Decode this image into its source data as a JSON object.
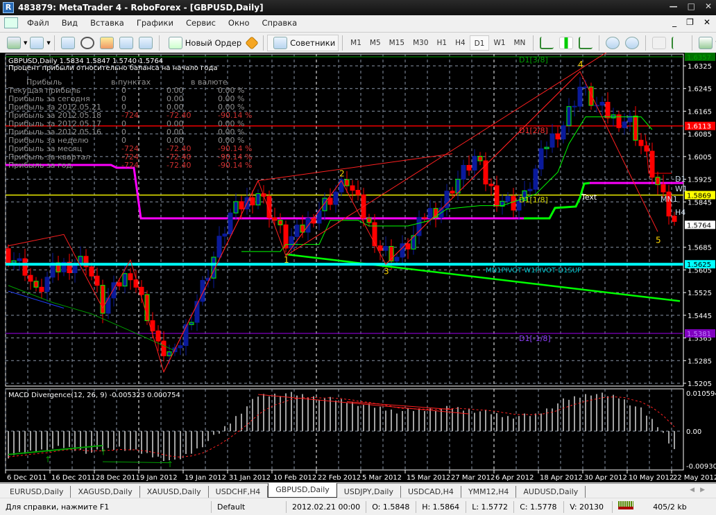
{
  "window": {
    "title": "483879: MetaTrader 4 - RoboForex - [GBPUSD,Daily]",
    "app_icon": "R"
  },
  "menu": [
    "Файл",
    "Вид",
    "Вставка",
    "Графики",
    "Сервис",
    "Окно",
    "Справка"
  ],
  "toolbar": {
    "new_order": "Новый Ордер",
    "experts": "Советники",
    "timeframes": [
      "M1",
      "M5",
      "M15",
      "M30",
      "H1",
      "H4",
      "D1",
      "W1",
      "MN"
    ],
    "active_timeframe": "D1"
  },
  "chart": {
    "symbol_info": "GBPUSD,Daily  1.5834 1.5847 1.5740 1.5764",
    "panel_title": "Процент прибыли относительно баланса на начало года",
    "panel_headers": [
      "Прибыль",
      "в пунктах",
      "в валюте"
    ],
    "panel_rows": [
      {
        "label": "Текущая прибыль",
        "points": "0",
        "money": "0.00",
        "pct": "0.00 %",
        "neg": false
      },
      {
        "label": "Прибыль за сегодня",
        "points": "0",
        "money": "0.00",
        "pct": "0.00 %",
        "neg": false
      },
      {
        "label": "Прибыль за 2012.05.21",
        "points": "0",
        "money": "0.00",
        "pct": "0.00 %",
        "neg": false
      },
      {
        "label": "Прибыль за 2012.05.18",
        "points": "-724",
        "money": "-72.40",
        "pct": "-90.14 %",
        "neg": true
      },
      {
        "label": "Прибыль за 2012.05.17",
        "points": "0",
        "money": "0.00",
        "pct": "0.00 %",
        "neg": false
      },
      {
        "label": "Прибыль за 2012.05.16",
        "points": "0",
        "money": "0.00",
        "pct": "0.00 %",
        "neg": false
      },
      {
        "label": "Прибыль за неделю",
        "points": "0",
        "money": "0.00",
        "pct": "0.00 %",
        "neg": false
      },
      {
        "label": "Прибыль за месяц",
        "points": "-724",
        "money": "-72.40",
        "pct": "-90.14 %",
        "neg": true
      },
      {
        "label": "Прибыль за квартал",
        "points": "-724",
        "money": "-72.40",
        "pct": "-90.14 %",
        "neg": true
      },
      {
        "label": "Прибыль за год",
        "points": "-724",
        "money": "-72.40",
        "pct": "-90.14 %",
        "neg": true
      }
    ],
    "price_range": [
      1.5195,
      1.6375
    ],
    "price_ticks": [
      "1.6325",
      "1.6245",
      "1.6165",
      "1.6085",
      "1.6005",
      "1.5925",
      "1.5845",
      "1.5685",
      "1.5605",
      "1.5525",
      "1.5445",
      "1.5365",
      "1.5285",
      "1.5205"
    ],
    "price_markers": [
      {
        "value": "1.6357",
        "bg": "#007000",
        "fg": "#00a000"
      },
      {
        "value": "1.6113",
        "bg": "#ff0000",
        "fg": "#ffffff"
      },
      {
        "value": "1.5869",
        "bg": "#ffff00",
        "fg": "#000000"
      },
      {
        "value": "1.5764",
        "bg": "#ffffff",
        "fg": "#000000"
      },
      {
        "value": "1.5625",
        "bg": "#00ffff",
        "fg": "#000000"
      },
      {
        "value": "1.5381",
        "bg": "#8000c0",
        "fg": "#c080ff"
      }
    ],
    "time_labels": [
      "6 Dec 2011",
      "16 Dec 2011",
      "28 Dec 2011",
      "9 Jan 2012",
      "19 Jan 2012",
      "31 Jan 2012",
      "10 Feb 2012",
      "22 Feb 2012",
      "5 Mar 2012",
      "15 Mar 2012",
      "27 Mar 2012",
      "6 Apr 2012",
      "18 Apr 2012",
      "30 Apr 2012",
      "10 May 2012",
      "22 May 2012"
    ],
    "close_keypoints": [
      [
        0,
        1.566
      ],
      [
        3,
        1.561
      ],
      [
        5,
        1.552
      ],
      [
        8,
        1.56
      ],
      [
        10,
        1.562
      ],
      [
        14,
        1.564
      ],
      [
        17,
        1.547
      ],
      [
        20,
        1.556
      ],
      [
        22,
        1.56
      ],
      [
        25,
        1.545
      ],
      [
        27,
        1.533
      ],
      [
        30,
        1.53
      ],
      [
        34,
        1.55
      ],
      [
        38,
        1.57
      ],
      [
        40,
        1.58
      ],
      [
        45,
        1.588
      ],
      [
        48,
        1.578
      ],
      [
        50,
        1.57
      ],
      [
        53,
        1.575
      ],
      [
        55,
        1.58
      ],
      [
        58,
        1.586
      ],
      [
        61,
        1.592
      ],
      [
        64,
        1.58
      ],
      [
        67,
        1.568
      ],
      [
        70,
        1.565
      ],
      [
        73,
        1.572
      ],
      [
        75,
        1.58
      ],
      [
        78,
        1.583
      ],
      [
        80,
        1.59
      ],
      [
        84,
        1.6
      ],
      [
        86,
        1.592
      ],
      [
        88,
        1.586
      ],
      [
        91,
        1.584
      ],
      [
        93,
        1.586
      ],
      [
        97,
        1.605
      ],
      [
        100,
        1.612
      ],
      [
        103,
        1.625
      ],
      [
        106,
        1.618
      ],
      [
        109,
        1.614
      ],
      [
        112,
        1.613
      ],
      [
        115,
        1.6
      ],
      [
        118,
        1.585
      ],
      [
        120,
        1.5764
      ]
    ],
    "levels": [
      {
        "price": 1.6357,
        "color": "#007000",
        "label": "D1[3/8]"
      },
      {
        "price": 1.6113,
        "color": "#ff0000",
        "label": "D1[2/8]"
      },
      {
        "price": 1.5869,
        "color": "#ffff00",
        "label": "D1[1/8]"
      },
      {
        "price": 1.5381,
        "color": "#8000c0",
        "label": "D1[-1/8]"
      }
    ],
    "pivot_line": {
      "price": 1.5625,
      "color": "#00ffff",
      "label": "MN1PIVOT W1PIVOT D1SUP"
    },
    "text_label": "Text",
    "right_labels": [
      "D1",
      "W1",
      "MN1",
      "H4"
    ],
    "zigzag": [
      [
        0,
        1.569
      ],
      [
        10,
        1.573
      ],
      [
        17,
        1.547
      ],
      [
        22,
        1.564
      ],
      [
        28,
        1.5245
      ],
      [
        45,
        1.592
      ],
      [
        50,
        1.5655
      ],
      [
        60,
        1.592
      ],
      [
        68,
        1.5625
      ],
      [
        103,
        1.6305
      ],
      [
        117,
        1.574
      ]
    ],
    "wave_labels": [
      {
        "text": "1",
        "at": [
          50,
          1.564
        ]
      },
      {
        "text": "2",
        "at": [
          60,
          1.5945
        ]
      },
      {
        "text": "3",
        "at": [
          68,
          1.56
        ]
      },
      {
        "text": "4",
        "at": [
          103,
          1.633
        ]
      },
      {
        "text": "5",
        "at": [
          117,
          1.571
        ]
      }
    ],
    "trend_line": [
      [
        50,
        1.566
      ],
      [
        121,
        1.5495
      ]
    ],
    "macd": {
      "label": "MACD Divergence(12, 26, 9) -0.005323 0.000754",
      "axis": [
        "0.010594",
        "0.00",
        "-0.00930"
      ],
      "range": [
        -0.0098,
        0.0114
      ],
      "hist_keypoints": [
        [
          0,
          -0.007
        ],
        [
          5,
          -0.0055
        ],
        [
          10,
          -0.0045
        ],
        [
          15,
          -0.006
        ],
        [
          20,
          -0.0045
        ],
        [
          25,
          -0.0065
        ],
        [
          30,
          -0.0085
        ],
        [
          34,
          -0.005
        ],
        [
          38,
          -0.0005
        ],
        [
          41,
          0.004
        ],
        [
          45,
          0.0098
        ],
        [
          50,
          0.0105
        ],
        [
          55,
          0.0095
        ],
        [
          60,
          0.0085
        ],
        [
          65,
          0.007
        ],
        [
          70,
          0.0055
        ],
        [
          75,
          0.006
        ],
        [
          80,
          0.0065
        ],
        [
          85,
          0.0055
        ],
        [
          90,
          0.004
        ],
        [
          95,
          0.0045
        ],
        [
          100,
          0.0085
        ],
        [
          105,
          0.0105
        ],
        [
          110,
          0.0095
        ],
        [
          114,
          0.006
        ],
        [
          117,
          0.0015
        ],
        [
          120,
          -0.005
        ]
      ]
    }
  },
  "tabs": [
    "EURUSD,Daily",
    "XAGUSD,Daily",
    "XAUUSD,Daily",
    "USDCHF,H4",
    "GBPUSD,Daily",
    "USDJPY,Daily",
    "USDCAD,H4",
    "YMM12,H4",
    "AUDUSD,Daily"
  ],
  "active_tab": "GBPUSD,Daily",
  "status": {
    "help": "Для справки, нажмите F1",
    "profile": "Default",
    "datetime": "2012.02.21 00:00",
    "open": "O: 1.5848",
    "high": "H: 1.5864",
    "low": "L: 1.5772",
    "close": "C: 1.5778",
    "volume": "V: 20130",
    "traffic": "405/2 kb"
  },
  "colors": {
    "bull": "#0a1a9a",
    "bear": "#ff0000",
    "grid": "#8a96a8",
    "magenta": "#ff00ff",
    "trail": "#00ff00"
  }
}
